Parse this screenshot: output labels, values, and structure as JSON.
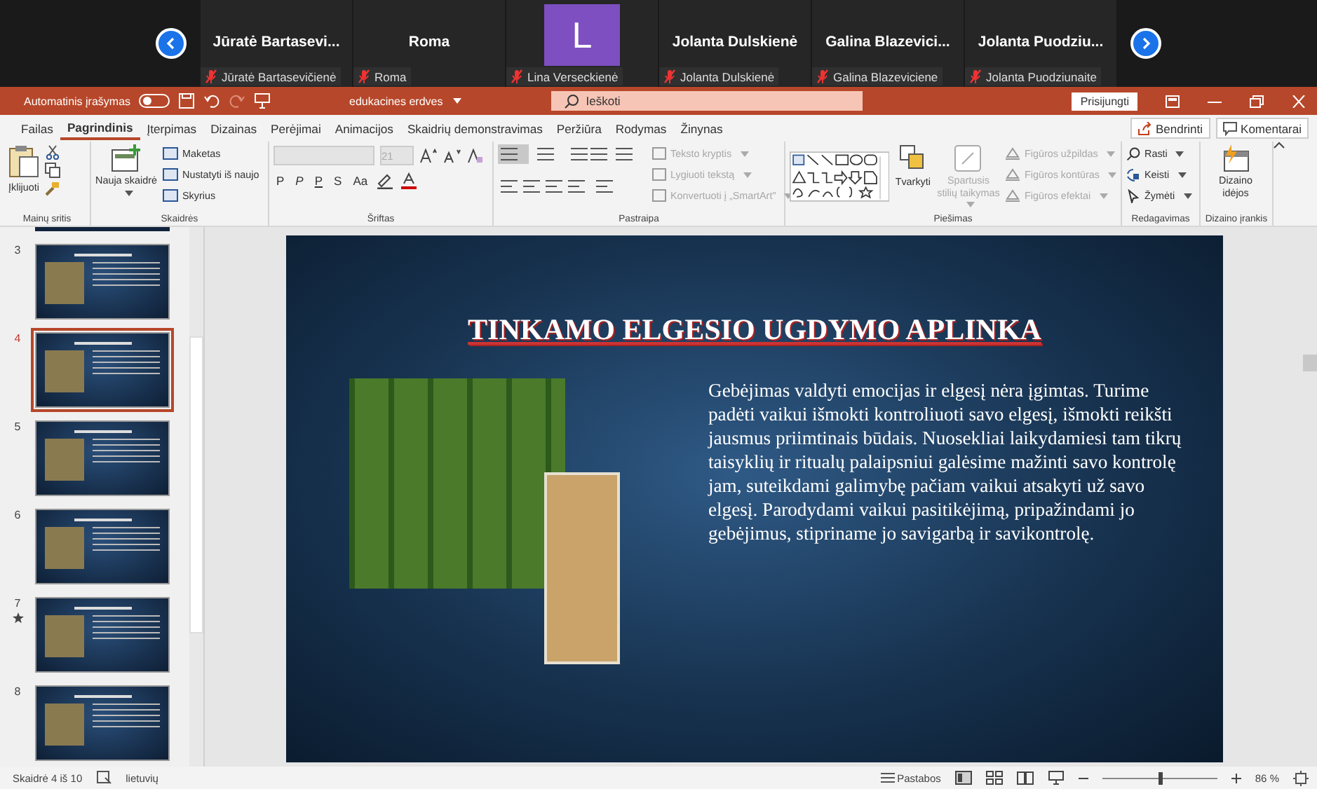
{
  "participants": {
    "tiles": [
      {
        "kind": "name",
        "title": "Jūratė Bartasevi...",
        "name": "Jūratė Bartasevičienė",
        "muted": true
      },
      {
        "kind": "name",
        "title": "Roma",
        "name": "Roma",
        "muted": true
      },
      {
        "kind": "avatar",
        "initial": "L",
        "name": "Lina Verseckienė",
        "muted": true
      },
      {
        "kind": "name",
        "title": "Jolanta Dulskienė",
        "name": "Jolanta Dulskienė",
        "muted": true
      },
      {
        "kind": "name",
        "title": "Galina Blazevici...",
        "name": "Galina Blazeviciene",
        "muted": true
      },
      {
        "kind": "name",
        "title": "Jolanta Puodziu...",
        "name": "Jolanta Puodziunaite",
        "muted": true
      }
    ]
  },
  "title_bar": {
    "autosave_label": "Automatinis įrašymas",
    "autosave_on": false,
    "document": "edukacines erdves",
    "search_placeholder": "Ieškoti",
    "sign_in": "Prisijungti"
  },
  "tabs": [
    {
      "label": "Failas",
      "selected": false
    },
    {
      "label": "Pagrindinis",
      "selected": true
    },
    {
      "label": "Įterpimas",
      "selected": false
    },
    {
      "label": "Dizainas",
      "selected": false
    },
    {
      "label": "Perėjimai",
      "selected": false
    },
    {
      "label": "Animacijos",
      "selected": false
    },
    {
      "label": "Skaidrių demonstravimas",
      "selected": false
    },
    {
      "label": "Peržiūra",
      "selected": false
    },
    {
      "label": "Rodymas",
      "selected": false
    },
    {
      "label": "Žinynas",
      "selected": false
    }
  ],
  "share": "Bendrinti",
  "comments": "Komentarai",
  "ribbon": [
    {
      "kind": "clipboard",
      "label": "Mainų sritis",
      "items": [
        {
          "label": "Įklijuoti",
          "disabled": false
        }
      ]
    },
    {
      "kind": "slides",
      "label": "Skaidrės",
      "items": [
        {
          "label": "Nauja skaidrė",
          "disabled": false
        },
        {
          "label": "Maketas",
          "disabled": false
        },
        {
          "label": "Nustatyti iš naujo",
          "disabled": false
        },
        {
          "label": "Skyrius",
          "disabled": false
        }
      ]
    },
    {
      "kind": "font",
      "label": "Šriftas",
      "font_size": "21",
      "items": [
        {
          "label": "P",
          "disabled": false
        },
        {
          "label": "P",
          "disabled": false
        },
        {
          "label": "P",
          "disabled": false
        },
        {
          "label": "S",
          "disabled": false
        },
        {
          "label": "Aa",
          "disabled": false
        }
      ]
    },
    {
      "kind": "paragraph",
      "label": "Pastraipa",
      "items": [
        {
          "label": "Teksto kryptis",
          "disabled": true
        },
        {
          "label": "Lygiuoti tekstą",
          "disabled": true
        },
        {
          "label": "Konvertuoti į „SmartArt\"",
          "disabled": true
        }
      ]
    },
    {
      "kind": "drawing",
      "label": "Piešimas",
      "items": [
        {
          "label": "Tvarkyti",
          "disabled": false
        },
        {
          "label": "Spartusis stilių taikymas",
          "disabled": true
        },
        {
          "label": "Figūros užpildas",
          "disabled": true
        },
        {
          "label": "Figūros kontūras",
          "disabled": true
        },
        {
          "label": "Figūros efektai",
          "disabled": true
        }
      ]
    },
    {
      "kind": "editing",
      "label": "Redagavimas",
      "items": [
        {
          "label": "Rasti",
          "disabled": false
        },
        {
          "label": "Keisti",
          "disabled": false
        },
        {
          "label": "Žymėti",
          "disabled": false
        }
      ]
    },
    {
      "kind": "designer",
      "label": "Dizaino įrankis",
      "items": [
        {
          "label": "Dizaino idėjos",
          "disabled": false
        }
      ]
    }
  ],
  "thumbnails": [
    {
      "number": "3",
      "selected": false,
      "animated": false
    },
    {
      "number": "4",
      "selected": true,
      "animated": false
    },
    {
      "number": "5",
      "selected": false,
      "animated": false
    },
    {
      "number": "6",
      "selected": false,
      "animated": false
    },
    {
      "number": "7",
      "selected": false,
      "animated": true
    },
    {
      "number": "8",
      "selected": false,
      "animated": false
    }
  ],
  "slide": {
    "title": "TINKAMO ELGESIO UGDYMO APLINKA",
    "body": "Gebėjimas valdyti emocijas ir elgesį nėra įgimtas. Turime padėti vaikui išmokti kontroliuoti savo elgesį, išmokti reikšti jausmus priimtinais būdais. Nuosekliai laikydamiesi tam tikrų taisyklių ir ritualų palaipsniui galėsime mažinti savo kontrolę jam, suteikdami galimybę pačiam vaikui atsakyti už savo elgesį. Parodydami vaikui pasitikėjimą, pripažindami jo gebėjimus, stipriname jo savigarbą ir savikontrolę."
  },
  "status_bar": {
    "slide_position": "Skaidrė 4 iš 10",
    "language": "lietuvių",
    "notes": "Pastabos",
    "zoom": "86 %",
    "zoom_slider": {
      "level": 0.5
    }
  }
}
